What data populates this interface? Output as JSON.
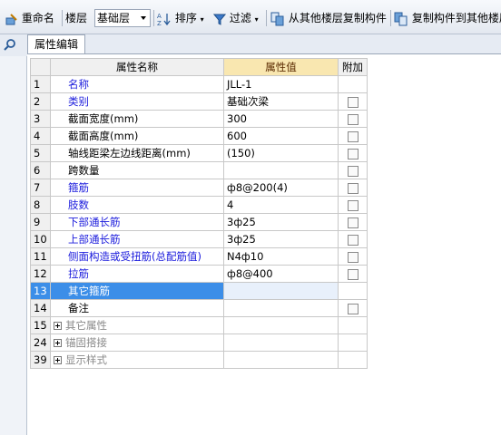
{
  "toolbar": {
    "rename": "重命名",
    "floor_label": "楼层",
    "floor_value": "基础层",
    "sort": "排序",
    "filter": "过滤",
    "copy_from": "从其他楼层复制构件",
    "copy_to": "复制构件到其他楼层"
  },
  "tab": {
    "label": "属性编辑"
  },
  "grid": {
    "headers": {
      "name": "属性名称",
      "value": "属性值",
      "extra": "附加"
    },
    "rows": [
      {
        "num": "1",
        "name": "名称",
        "value": "JLL-1",
        "style": "blue",
        "checkbox": false
      },
      {
        "num": "2",
        "name": "类别",
        "value": "基础次梁",
        "style": "blue",
        "checkbox": true
      },
      {
        "num": "3",
        "name": "截面宽度(mm)",
        "value": "300",
        "style": "normal",
        "checkbox": true
      },
      {
        "num": "4",
        "name": "截面高度(mm)",
        "value": "600",
        "style": "normal",
        "checkbox": true
      },
      {
        "num": "5",
        "name": "轴线距梁左边线距离(mm)",
        "value": "(150)",
        "style": "normal",
        "checkbox": true
      },
      {
        "num": "6",
        "name": "跨数量",
        "value": "",
        "style": "normal",
        "checkbox": true
      },
      {
        "num": "7",
        "name": "箍筋",
        "value": "ф8@200(4)",
        "style": "blue",
        "checkbox": true
      },
      {
        "num": "8",
        "name": "肢数",
        "value": "4",
        "style": "blue",
        "checkbox": true
      },
      {
        "num": "9",
        "name": "下部通长筋",
        "value": "3ф25",
        "style": "blue",
        "checkbox": true
      },
      {
        "num": "10",
        "name": "上部通长筋",
        "value": "3ф25",
        "style": "blue",
        "checkbox": true
      },
      {
        "num": "11",
        "name": "侧面构造或受扭筋(总配筋值)",
        "value": "N4ф10",
        "style": "blue",
        "checkbox": true
      },
      {
        "num": "12",
        "name": "拉筋",
        "value": "ф8@400",
        "style": "blue",
        "checkbox": true
      },
      {
        "num": "13",
        "name": "其它箍筋",
        "value": "",
        "style": "selected",
        "checkbox": false
      },
      {
        "num": "14",
        "name": "备注",
        "value": "",
        "style": "normal",
        "checkbox": true
      },
      {
        "num": "15",
        "name": "其它属性",
        "value": "",
        "style": "group",
        "checkbox": false
      },
      {
        "num": "24",
        "name": "锚固搭接",
        "value": "",
        "style": "group",
        "checkbox": false
      },
      {
        "num": "39",
        "name": "显示样式",
        "value": "",
        "style": "group",
        "checkbox": false
      }
    ]
  },
  "icons": {
    "rename": "rename-icon",
    "sort": "sort-az-icon",
    "filter": "funnel-icon",
    "copy_from": "copy-from-floor-icon",
    "copy_to": "copy-to-floor-icon",
    "search": "search-icon"
  },
  "colors": {
    "blue_text": "#1a1adc",
    "selection": "#3c8ee8",
    "header_value_bg": "#f9e7b0"
  }
}
